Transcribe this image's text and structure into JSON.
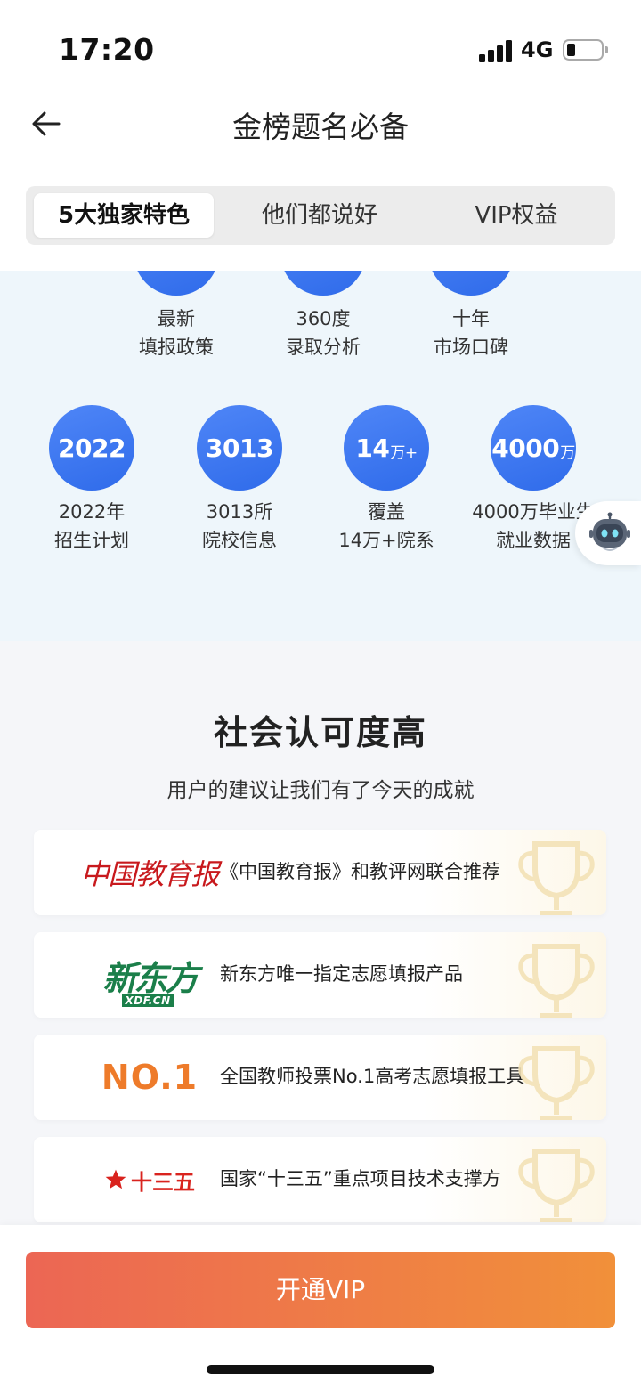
{
  "status_bar": {
    "time": "17:20",
    "network": "4G"
  },
  "header": {
    "title": "金榜题名必备"
  },
  "tabs": [
    {
      "label": "5大独家特色"
    },
    {
      "label": "他们都说好"
    },
    {
      "label": "VIP权益"
    }
  ],
  "features": {
    "top_row": [
      {
        "line1": "最新",
        "line2": "填报政策"
      },
      {
        "line1": "360度",
        "line2": "录取分析"
      },
      {
        "line1": "十年",
        "line2": "市场口碑"
      }
    ],
    "bottom_row": [
      {
        "num": "2022",
        "unit": "",
        "line1": "2022年",
        "line2": "招生计划"
      },
      {
        "num": "3013",
        "unit": "",
        "line1": "3013所",
        "line2": "院校信息"
      },
      {
        "num": "14",
        "unit": "万+",
        "line1": "覆盖",
        "line2": "14万+院系"
      },
      {
        "num": "4000",
        "unit": "万",
        "line1": "4000万毕业生",
        "line2": "就业数据"
      }
    ]
  },
  "social": {
    "title": "社会认可度高",
    "subtitle": "用户的建议让我们有了今天的成就",
    "cards": [
      {
        "logo": "中国教育报",
        "text": "《中国教育报》和教评网联合推荐"
      },
      {
        "logo": "新东方",
        "logo_sub": "XDF.CN",
        "text": "新东方唯一指定志愿填报产品"
      },
      {
        "logo": "NO.1",
        "text": "全国教师投票No.1高考志愿填报工具"
      },
      {
        "logo": "十三五",
        "text": "国家“十三五”重点项目技术支撑方"
      }
    ]
  },
  "cta": {
    "label": "开通VIP"
  },
  "colors": {
    "feature_blue": "#3a74f0",
    "cta_start": "#ec6654",
    "cta_end": "#f1903a",
    "accent_red": "#d9231e",
    "accent_green": "#1b7f4a",
    "accent_orange": "#ee7b2a"
  },
  "icons": [
    "signal-icon",
    "battery-icon",
    "back-arrow-icon",
    "robot-assistant-icon",
    "trophy-icon",
    "star-icon"
  ]
}
